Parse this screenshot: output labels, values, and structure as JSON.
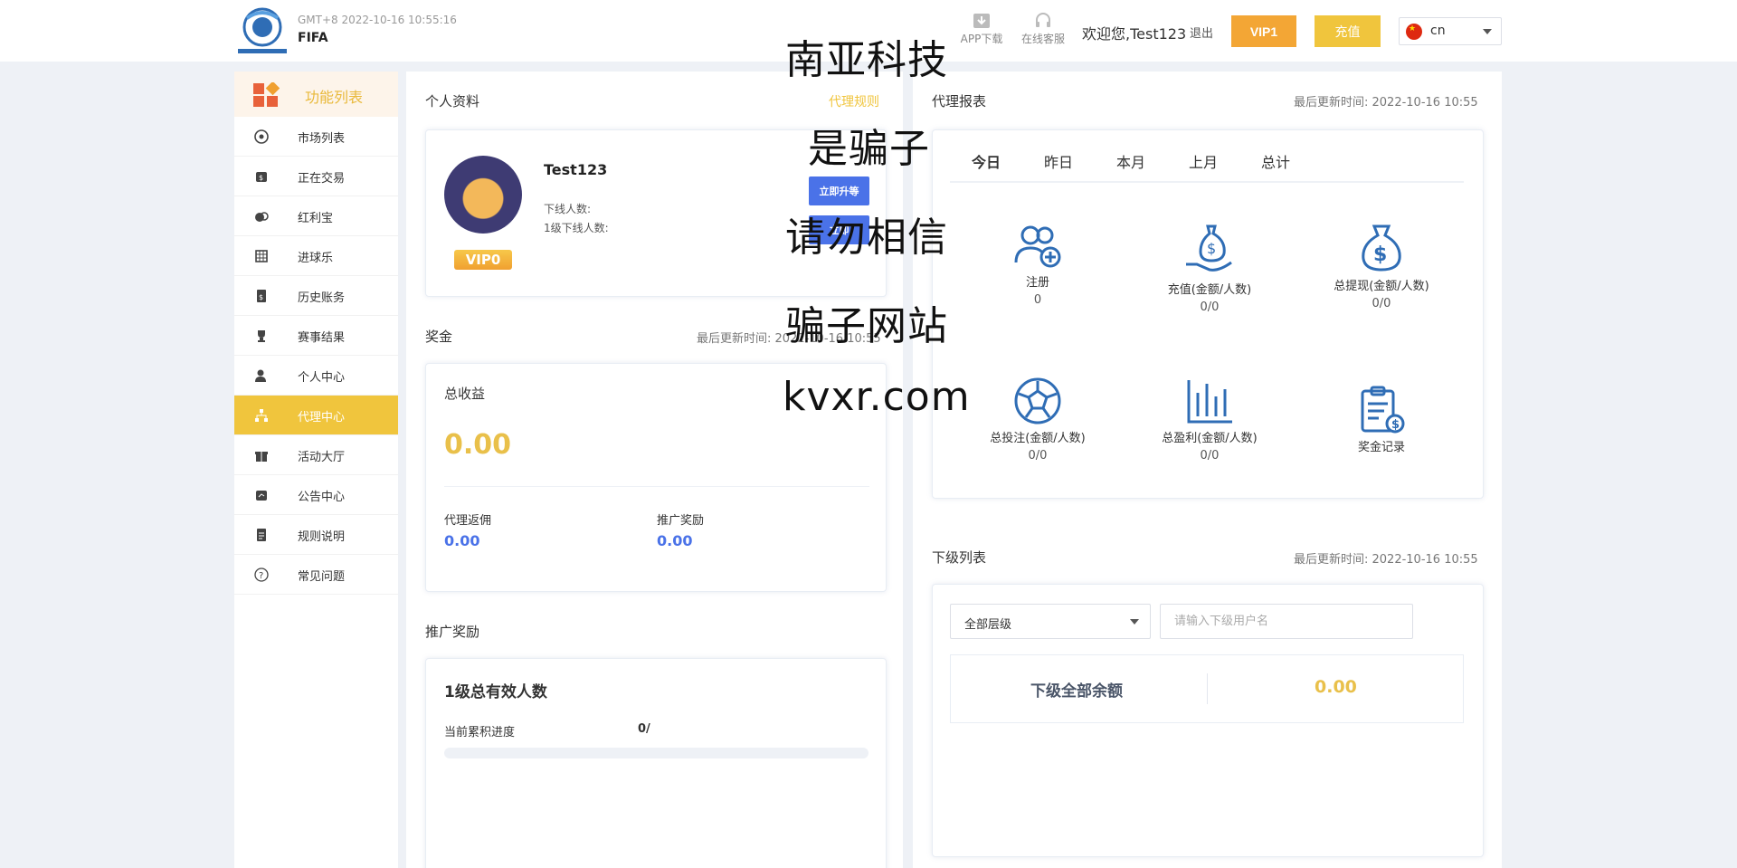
{
  "header": {
    "timezone_time": "GMT+8   2022-10-16 10:55:16",
    "site_name": "FIFA",
    "app_download": "APP下载",
    "online_service": "在线客服",
    "welcome": "欢迎您,Test123",
    "logout": "退出",
    "vip_button": "VIP1",
    "recharge_button": "充值",
    "language": "cn"
  },
  "sidebar": {
    "title": "功能列表",
    "items": [
      {
        "label": "市场列表",
        "icon": "soccer-ball-icon"
      },
      {
        "label": "正在交易",
        "icon": "money-bag-icon"
      },
      {
        "label": "红利宝",
        "icon": "coins-icon"
      },
      {
        "label": "进球乐",
        "icon": "goal-net-icon"
      },
      {
        "label": "历史账务",
        "icon": "ledger-icon"
      },
      {
        "label": "赛事结果",
        "icon": "trophy-icon"
      },
      {
        "label": "个人中心",
        "icon": "user-icon"
      },
      {
        "label": "代理中心",
        "icon": "org-chart-icon"
      },
      {
        "label": "活动大厅",
        "icon": "gift-icon"
      },
      {
        "label": "公告中心",
        "icon": "announcement-icon"
      },
      {
        "label": "规则说明",
        "icon": "document-icon"
      },
      {
        "label": "常见问题",
        "icon": "question-icon"
      }
    ],
    "active_index": 7
  },
  "profile": {
    "section_title": "个人资料",
    "agent_rules_link": "代理规则",
    "username": "Test123",
    "downline_count_label": "下线人数:",
    "level1_downline_label": "1级下线人数:",
    "vip_badge": "VIP0",
    "upgrade_button": "立即升等",
    "second_button": "立即"
  },
  "bonus": {
    "section_title": "奖金",
    "last_update": "最后更新时间: 2022-10-16 10:55",
    "total_income_label": "总收益",
    "total_income": "0.00",
    "agent_commission_label": "代理返佣",
    "agent_commission": "0.00",
    "promo_reward_label": "推广奖励",
    "promo_reward": "0.00"
  },
  "promotion": {
    "section_title": "推广奖励",
    "heading": "1级总有效人数",
    "progress_label": "当前累积进度",
    "progress_value": "0/",
    "progress_fraction": 0
  },
  "report": {
    "section_title": "代理报表",
    "last_update": "最后更新时间: 2022-10-16 10:55",
    "tabs": [
      "今日",
      "昨日",
      "本月",
      "上月",
      "总计"
    ],
    "active_tab": 0,
    "stats": [
      {
        "label": "注册",
        "value": "0",
        "icon": "register-users-icon"
      },
      {
        "label": "充值(金额/人数)",
        "value": "0/0",
        "icon": "money-bag-hand-icon"
      },
      {
        "label": "总提现(金额/人数)",
        "value": "0/0",
        "icon": "dollar-bag-icon"
      },
      {
        "label": "总投注(金额/人数)",
        "value": "0/0",
        "icon": "soccer-ball-icon"
      },
      {
        "label": "总盈利(金额/人数)",
        "value": "0/0",
        "icon": "bar-chart-icon"
      },
      {
        "label": "奖金记录",
        "value": "",
        "icon": "clipboard-dollar-icon"
      }
    ]
  },
  "subordinates": {
    "section_title": "下级列表",
    "last_update": "最后更新时间: 2022-10-16 10:55",
    "level_select": "全部层级",
    "search_placeholder": "请输入下级用户名",
    "balance_label": "下级全部余额",
    "balance_value": "0.00"
  },
  "watermark": [
    "南亚科技",
    "是骗子",
    "请勿相信",
    "骗子网站",
    "kvxr.com"
  ],
  "colors": {
    "accent_yellow": "#f0c53d",
    "accent_orange": "#f3a635",
    "blue": "#4a72e8",
    "icon_blue": "#2f6db5"
  }
}
